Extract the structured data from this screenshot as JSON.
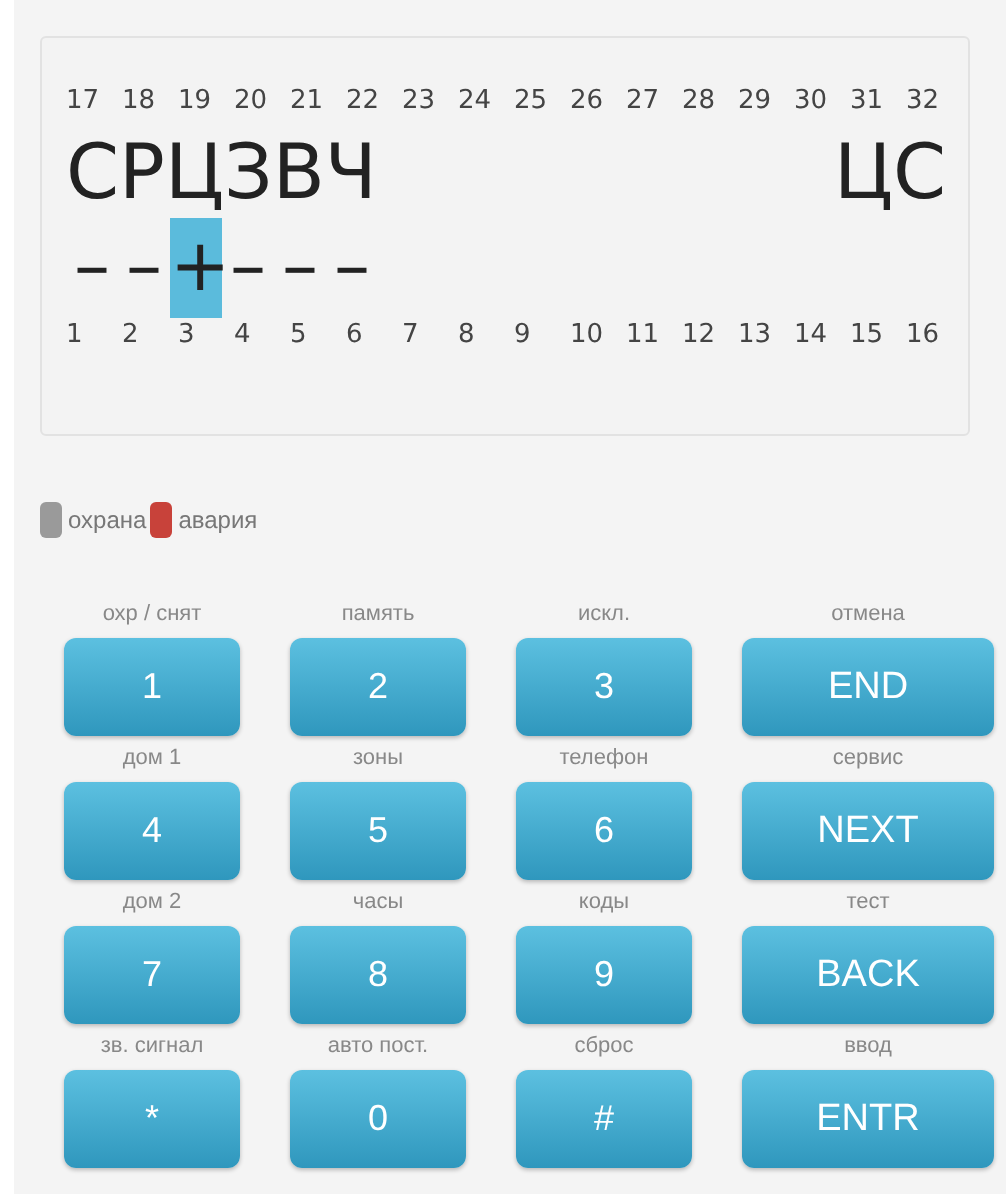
{
  "display": {
    "top_numbers": [
      "17",
      "18",
      "19",
      "20",
      "21",
      "22",
      "23",
      "24",
      "25",
      "26",
      "27",
      "28",
      "29",
      "30",
      "31",
      "32"
    ],
    "line1_left": "СРЦЗВЧ",
    "line1_right": "ЦС",
    "line2": [
      {
        "char": "–",
        "selected": false
      },
      {
        "char": "–",
        "selected": false
      },
      {
        "char": "+",
        "selected": true
      },
      {
        "char": "–",
        "selected": false
      },
      {
        "char": "–",
        "selected": false
      },
      {
        "char": "–",
        "selected": false
      }
    ],
    "bottom_numbers": [
      "1",
      "2",
      "3",
      "4",
      "5",
      "6",
      "7",
      "8",
      "9",
      "10",
      "11",
      "12",
      "13",
      "14",
      "15",
      "16"
    ]
  },
  "legend": [
    {
      "label": "охрана",
      "color": "#9a9a9a"
    },
    {
      "label": "авария",
      "color": "#c8423a"
    }
  ],
  "keys": [
    {
      "caption": "охр / снят",
      "label": "1",
      "kind": "digit"
    },
    {
      "caption": "память",
      "label": "2",
      "kind": "digit"
    },
    {
      "caption": "искл.",
      "label": "3",
      "kind": "digit"
    },
    {
      "caption": "отмена",
      "label": "END",
      "kind": "command"
    },
    {
      "caption": "дом 1",
      "label": "4",
      "kind": "digit"
    },
    {
      "caption": "зоны",
      "label": "5",
      "kind": "digit"
    },
    {
      "caption": "телефон",
      "label": "6",
      "kind": "digit"
    },
    {
      "caption": "сервис",
      "label": "NEXT",
      "kind": "command"
    },
    {
      "caption": "дом 2",
      "label": "7",
      "kind": "digit"
    },
    {
      "caption": "часы",
      "label": "8",
      "kind": "digit"
    },
    {
      "caption": "коды",
      "label": "9",
      "kind": "digit"
    },
    {
      "caption": "тест",
      "label": "BACK",
      "kind": "command"
    },
    {
      "caption": "зв. сигнал",
      "label": "*",
      "kind": "digit"
    },
    {
      "caption": "авто пост.",
      "label": "0",
      "kind": "digit"
    },
    {
      "caption": "сброс",
      "label": "#",
      "kind": "digit"
    },
    {
      "caption": "ввод",
      "label": "ENTR",
      "kind": "command"
    }
  ]
}
